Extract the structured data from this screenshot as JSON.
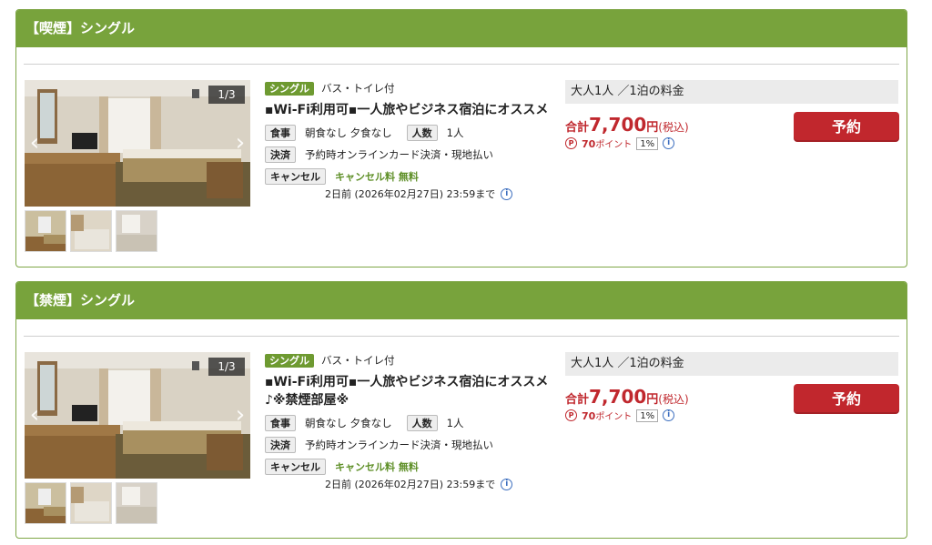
{
  "plans": [
    {
      "header": "【喫煙】シングル",
      "gallery": {
        "counter": "1/3",
        "prev_icon": "‹",
        "next_icon": "›"
      },
      "room_type": "シングル",
      "bath": "バス・トイレ付",
      "title": "▪Wi-Fi利用可▪一人旅やビジネス宿泊にオススメ",
      "meal_label": "食事",
      "meal_value": "朝食なし 夕食なし",
      "people_label": "人数",
      "people_value": "1人",
      "payment_label": "決済",
      "payment_value": "予約時オンラインカード決済・現地払い",
      "cancel_label": "キャンセル",
      "cancel_fee": "キャンセル料 無料",
      "cancel_deadline": "2日前 (2026年02月27日) 23:59まで",
      "price_head": "大人1人 ／1泊の料金",
      "total_label": "合計",
      "amount": "7,700",
      "yen": "円",
      "tax": "(税込)",
      "points": "70",
      "points_unit": "ポイント",
      "rate": "1%",
      "reserve_label": "予約"
    },
    {
      "header": "【禁煙】シングル",
      "gallery": {
        "counter": "1/3",
        "prev_icon": "‹",
        "next_icon": "›"
      },
      "room_type": "シングル",
      "bath": "バス・トイレ付",
      "title": "▪Wi-Fi利用可▪一人旅やビジネス宿泊にオススメ♪※禁煙部屋※",
      "meal_label": "食事",
      "meal_value": "朝食なし 夕食なし",
      "people_label": "人数",
      "people_value": "1人",
      "payment_label": "決済",
      "payment_value": "予約時オンラインカード決済・現地払い",
      "cancel_label": "キャンセル",
      "cancel_fee": "キャンセル料 無料",
      "cancel_deadline": "2日前 (2026年02月27日) 23:59まで",
      "price_head": "大人1人 ／1泊の料金",
      "total_label": "合計",
      "amount": "7,700",
      "yen": "円",
      "tax": "(税込)",
      "points": "70",
      "points_unit": "ポイント",
      "rate": "1%",
      "reserve_label": "予約"
    }
  ],
  "colors": {
    "header_green": "#78a33c",
    "reserve_red": "#c1272d",
    "price_red": "#c0282e"
  },
  "icons": [
    "chevron-left-icon",
    "chevron-right-icon",
    "info-icon",
    "points-icon"
  ]
}
